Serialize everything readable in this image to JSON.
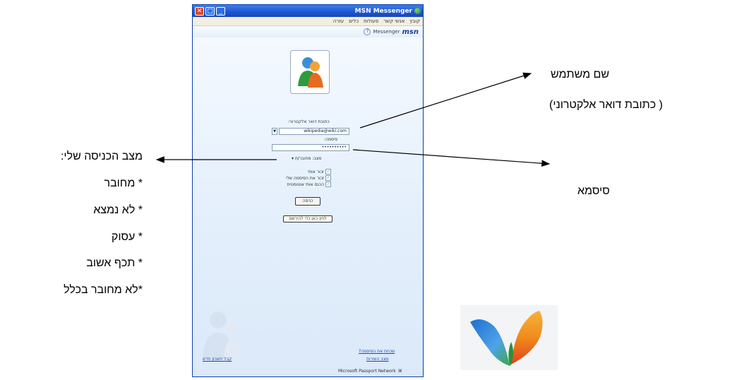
{
  "window": {
    "title": "MSN Messenger",
    "menu": [
      "קובץ",
      "אנשי קשר",
      "פעולות",
      "כלים",
      "עזרה"
    ],
    "brand": "msn",
    "brand_sub": "Messenger"
  },
  "login": {
    "email_label": "כתובת דואר אלקטרוני:",
    "email_value": "wikipedia@wiki.com",
    "password_label": "סיסמה:",
    "password_value": "••••••••••",
    "status_label": "מצב:",
    "status_value": "מחובר/ת",
    "checkboxes": [
      "זכור אותי",
      "זכור את הסיסמה שלי",
      "הכנס אותי אוטומטית"
    ],
    "signin_button": "כניסה",
    "signup_button": "לחץ כאן כדי להירשם",
    "forgot_link": "שכחת את הסיסמה?",
    "service_status_link": "מצב השירות",
    "new_account_link": "קבל חשבון חדש",
    "passport": "Microsoft Passport Network"
  },
  "annotations": {
    "username_line1": "שם משתמש",
    "username_line2": "( כתובת דואר אלקטרוני)",
    "password": "סיסמא",
    "status_title": "מצב  הכניסה שלי:",
    "statuses": [
      "* מחובר",
      "* לא נמצא",
      "* עסוק",
      "* תכף אשוב",
      "*לא מחובר בכלל"
    ]
  },
  "colors": {
    "titlebar": "#1d55cf",
    "window_bg": "#eef5fd",
    "link": "#1b46b5",
    "butterfly_blue": "#1d6fd1",
    "butterfly_orange": "#f08a1c",
    "butterfly_green": "#3aa847"
  }
}
